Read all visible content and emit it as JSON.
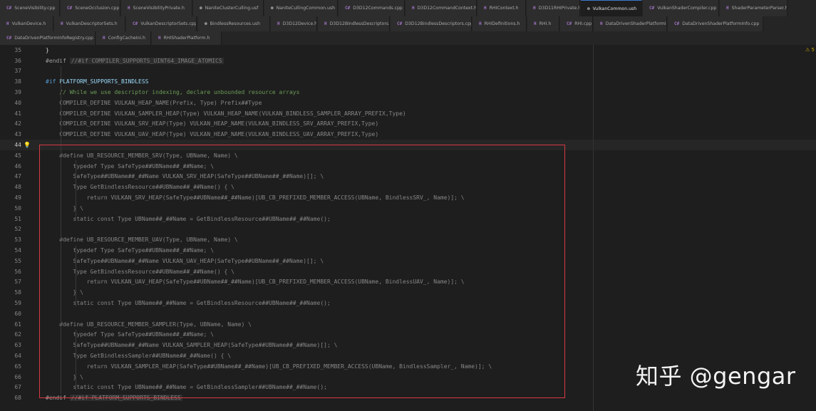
{
  "tabs": {
    "row1": [
      {
        "type": "cpp",
        "label": "SceneVisibility.cpp"
      },
      {
        "type": "cpp",
        "label": "SceneOcclusion.cpp"
      },
      {
        "type": "h",
        "label": "SceneVisibilityPrivate.h"
      },
      {
        "type": "ush",
        "label": "NaniteClusterCulling.usf"
      },
      {
        "type": "ush",
        "label": "NaniteCullingCommon.ush"
      },
      {
        "type": "cpp",
        "label": "D3D12Commands.cpp"
      },
      {
        "type": "h",
        "label": "D3D12CommandContext.h"
      },
      {
        "type": "h",
        "label": "RHIContext.h"
      },
      {
        "type": "h",
        "label": "D3D11RHIPrivate.h"
      },
      {
        "type": "ush",
        "label": "VulkanCommon.ush",
        "active": true
      },
      {
        "type": "cpp",
        "label": "VulkanShaderCompiler.cpp"
      },
      {
        "type": "h",
        "label": "ShaderParameterParser.h"
      }
    ],
    "row2": [
      {
        "type": "h",
        "label": "VulkanDevice.h"
      },
      {
        "type": "h",
        "label": "VulkanDescriptorSets.h"
      },
      {
        "type": "cpp",
        "label": "VulkanDescriptorSets.cpp"
      },
      {
        "type": "ush",
        "label": "BindlessResources.ush"
      },
      {
        "type": "h",
        "label": "D3D12Device.h"
      },
      {
        "type": "h",
        "label": "D3D12BindlessDescriptors.h"
      },
      {
        "type": "cpp",
        "label": "D3D12BindlessDescriptors.cpp"
      },
      {
        "type": "h",
        "label": "RHIDefinitions.h"
      },
      {
        "type": "h",
        "label": "RHI.h"
      },
      {
        "type": "cpp",
        "label": "RHI.cpp"
      },
      {
        "type": "h",
        "label": "DataDrivenShaderPlatformInfo.h"
      },
      {
        "type": "cpp",
        "label": "DataDrivenShaderPlatformInfo.cpp"
      }
    ],
    "row3": [
      {
        "type": "cpp",
        "label": "DataDrivenPlatformInfoRegistry.cpp"
      },
      {
        "type": "h",
        "label": "ConfigCacheIni.h"
      },
      {
        "type": "h",
        "label": "RHIShaderPlatform.h"
      }
    ]
  },
  "icons": {
    "cpp": "C#",
    "h": "H",
    "ush": "⊗"
  },
  "problems_badge": "⚠ 5",
  "watermark": "知乎 @gengar",
  "lines": [
    {
      "n": "35",
      "text": "}"
    },
    {
      "n": "36",
      "text": "#endif //#if COMPILER_SUPPORTS_UINT64_IMAGE_ATOMICS"
    },
    {
      "n": "37",
      "text": ""
    },
    {
      "n": "38",
      "text": "#if PLATFORM_SUPPORTS_BINDLESS"
    },
    {
      "n": "39",
      "text": "    // While we use descriptor indexing, declare unbounded resource arrays"
    },
    {
      "n": "40",
      "text": "    COMPILER_DEFINE VULKAN_HEAP_NAME(Prefix, Type) Prefix##Type"
    },
    {
      "n": "41",
      "text": "    COMPILER_DEFINE VULKAN_SAMPLER_HEAP(Type) VULKAN_HEAP_NAME(VULKAN_BINDLESS_SAMPLER_ARRAY_PREFIX,Type)"
    },
    {
      "n": "42",
      "text": "    COMPILER_DEFINE VULKAN_SRV_HEAP(Type) VULKAN_HEAP_NAME(VULKAN_BINDLESS_SRV_ARRAY_PREFIX,Type)"
    },
    {
      "n": "43",
      "text": "    COMPILER_DEFINE VULKAN_UAV_HEAP(Type) VULKAN_HEAP_NAME(VULKAN_BINDLESS_UAV_ARRAY_PREFIX,Type)"
    },
    {
      "n": "44",
      "text": ""
    },
    {
      "n": "45",
      "text": "    #define UB_RESOURCE_MEMBER_SRV(Type, UBName, Name) \\"
    },
    {
      "n": "46",
      "text": "        typedef Type SafeType##UBName##_##Name; \\"
    },
    {
      "n": "47",
      "text": "        SafeType##UBName##_##Name VULKAN_SRV_HEAP(SafeType##UBName##_##Name)[]; \\"
    },
    {
      "n": "48",
      "text": "        Type GetBindlessResource##UBName##_##Name() { \\"
    },
    {
      "n": "49",
      "text": "            return VULKAN_SRV_HEAP(SafeType##UBName##_##Name)[UB_CB_PREFIXED_MEMBER_ACCESS(UBName, BindlessSRV_, Name)]; \\"
    },
    {
      "n": "50",
      "text": "        } \\"
    },
    {
      "n": "51",
      "text": "        static const Type UBName##_##Name = GetBindlessResource##UBName##_##Name();"
    },
    {
      "n": "52",
      "text": ""
    },
    {
      "n": "53",
      "text": "    #define UB_RESOURCE_MEMBER_UAV(Type, UBName, Name) \\"
    },
    {
      "n": "54",
      "text": "        typedef Type SafeType##UBName##_##Name; \\"
    },
    {
      "n": "55",
      "text": "        SafeType##UBName##_##Name VULKAN_UAV_HEAP(SafeType##UBName##_##Name)[]; \\"
    },
    {
      "n": "56",
      "text": "        Type GetBindlessResource##UBName##_##Name() { \\"
    },
    {
      "n": "57",
      "text": "            return VULKAN_UAV_HEAP(SafeType##UBName##_##Name)[UB_CB_PREFIXED_MEMBER_ACCESS(UBName, BindlessUAV_, Name)]; \\"
    },
    {
      "n": "58",
      "text": "        } \\"
    },
    {
      "n": "59",
      "text": "        static const Type UBName##_##Name = GetBindlessResource##UBName##_##Name();"
    },
    {
      "n": "60",
      "text": ""
    },
    {
      "n": "61",
      "text": "    #define UB_RESOURCE_MEMBER_SAMPLER(Type, UBName, Name) \\"
    },
    {
      "n": "62",
      "text": "        typedef Type SafeType##UBName##_##Name; \\"
    },
    {
      "n": "63",
      "text": "        SafeType##UBName##_##Name VULKAN_SAMPLER_HEAP(SafeType##UBName##_##Name)[]; \\"
    },
    {
      "n": "64",
      "text": "        Type GetBindlessSampler##UBName##_##Name() { \\"
    },
    {
      "n": "65",
      "text": "            return VULKAN_SAMPLER_HEAP(SafeType##UBName##_##Name)[UB_CB_PREFIXED_MEMBER_ACCESS(UBName, BindlessSampler_, Name)]; \\"
    },
    {
      "n": "66",
      "text": "        } \\"
    },
    {
      "n": "67",
      "text": "        static const Type UBName##_##Name = GetBindlessSampler##UBName##_##Name();"
    },
    {
      "n": "68",
      "text": "#endif //#if PLATFORM_SUPPORTS_BINDLESS"
    }
  ]
}
